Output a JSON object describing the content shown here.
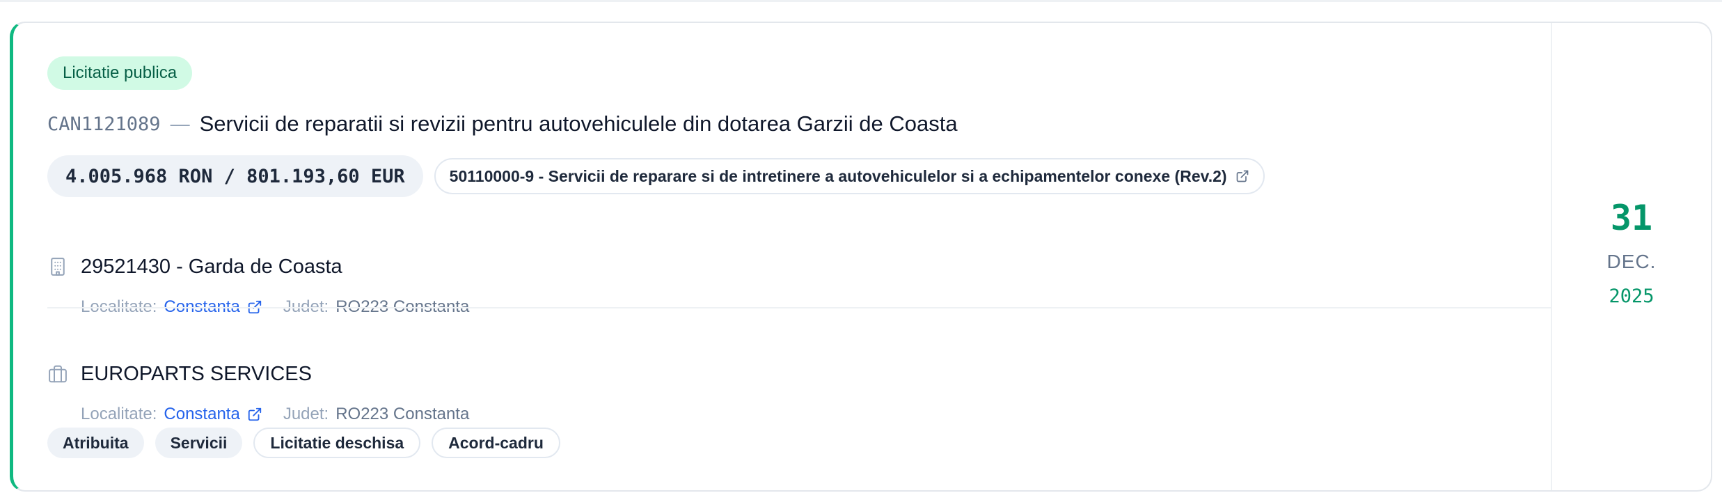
{
  "notice": {
    "procedure_badge": "Licitatie publica",
    "code": "CAN1121089",
    "separator": "—",
    "title": "Servicii de reparatii si revizii pentru autovehiculele din dotarea Garzii de Coasta",
    "value": "4.005.968 RON / 801.193,60 EUR",
    "cpv": "50110000-9 - Servicii de reparare si de intretinere a autovehiculelor si a echipamentelor conexe (Rev.2)"
  },
  "authority": {
    "icon": "building-icon",
    "name": "29521430 - Garda de Coasta",
    "locality_label": "Localitate:",
    "locality": "Constanta",
    "county_label": "Judet:",
    "county": "RO223 Constanta"
  },
  "supplier": {
    "icon": "briefcase-icon",
    "name": "EUROPARTS SERVICES",
    "locality_label": "Localitate:",
    "locality": "Constanta",
    "county_label": "Judet:",
    "county": "RO223 Constanta"
  },
  "tags": [
    "Atribuita",
    "Servicii",
    "Licitatie deschisa",
    "Acord-cadru"
  ],
  "date": {
    "day": "31",
    "month": "DEC.",
    "year": "2025"
  },
  "colors": {
    "accent": "#10b981",
    "link": "#2563eb",
    "badge_bg": "#d1fae5"
  }
}
